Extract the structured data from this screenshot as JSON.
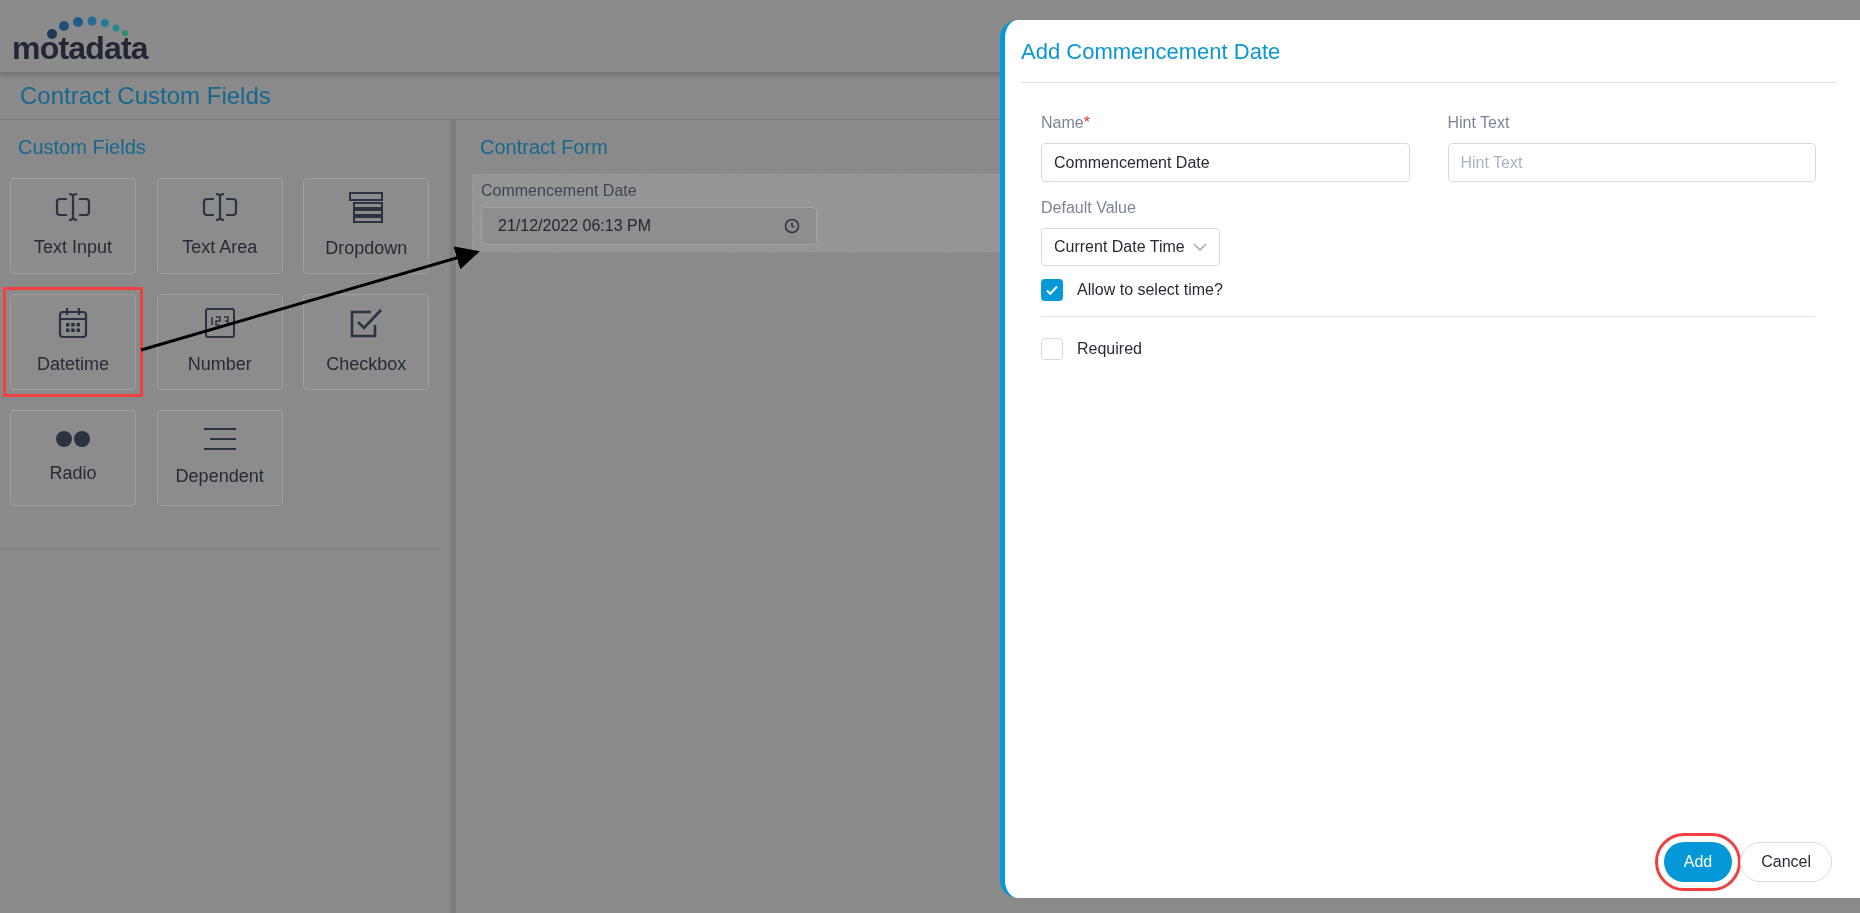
{
  "header": {
    "logo": "motadata"
  },
  "page_title": "Contract Custom Fields",
  "custom_fields": {
    "title": "Custom Fields",
    "tiles": [
      {
        "label": "Text Input",
        "kind": "text",
        "highlighted": false
      },
      {
        "label": "Text Area",
        "kind": "text",
        "highlighted": false
      },
      {
        "label": "Dropdown",
        "kind": "dropdown",
        "highlighted": false
      },
      {
        "label": "Datetime",
        "kind": "calendar",
        "highlighted": true
      },
      {
        "label": "Number",
        "kind": "number",
        "highlighted": false
      },
      {
        "label": "Checkbox",
        "kind": "checkbox",
        "highlighted": false
      },
      {
        "label": "Radio",
        "kind": "radio",
        "highlighted": false
      },
      {
        "label": "Dependent",
        "kind": "lines",
        "highlighted": false
      }
    ]
  },
  "contract_form": {
    "title": "Contract Form",
    "field": {
      "label": "Commencement Date",
      "value": "21/12/2022 06:13 PM"
    }
  },
  "modal": {
    "title": "Add Commencement Date",
    "name": {
      "label": "Name",
      "required_mark": "*",
      "value": "Commencement Date"
    },
    "hint": {
      "label": "Hint Text",
      "placeholder": "Hint Text"
    },
    "default_value": {
      "label": "Default Value",
      "value": "Current Date Time"
    },
    "allow_time": {
      "label": "Allow to select time?",
      "checked": true
    },
    "required": {
      "label": "Required",
      "checked": false
    },
    "buttons": [
      {
        "label": "Add",
        "kind": "primary",
        "highlighted": true
      },
      {
        "label": "Cancel",
        "kind": "secondary",
        "highlighted": false
      }
    ]
  }
}
